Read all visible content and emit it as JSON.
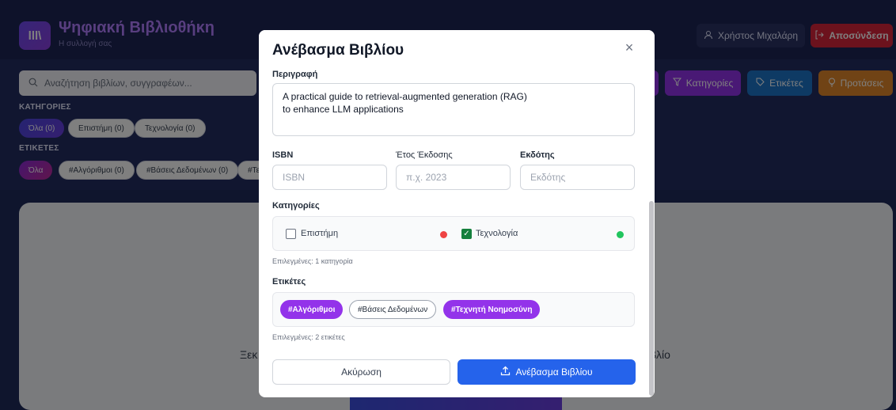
{
  "app": {
    "logo_text": "lll\\",
    "title": "Ψηφιακή Βιβλιοθήκη",
    "subtitle": "Η συλλογή σας",
    "user_name": "Χρήστος Μιχαλάρη",
    "logout_label": "Αποσύνδεση"
  },
  "search": {
    "placeholder": "Αναζήτηση βιβλίων, συγγραφέων..."
  },
  "filters": {
    "categories_label": "ΚΑΤΗΓΟΡΙΕΣ",
    "category_chips": [
      "Όλα (0)",
      "Επιστήμη (0)",
      "Τεχνολογία (0)"
    ],
    "tags_label": "ΕΤΙΚΕΤΕΣ",
    "tag_chips": [
      "Όλα",
      "#Αλγόριθμοι (0)",
      "#Βάσεις Δεδομένων (0)",
      "#Τε"
    ]
  },
  "toolbar": {
    "categories_label": "Κατηγορίες",
    "tags_label": "Ετικέτες",
    "suggestions_label": "Προτάσεις"
  },
  "background": {
    "empty_text_left": "Ξεκ",
    "empty_text_right": "βλίο"
  },
  "modal": {
    "title": "Ανέβασμα Βιβλίου",
    "close_icon": "×",
    "description_label": "Περιγραφή",
    "description_value": "A practical guide to retrieval-augmented generation (RAG)\nto enhance LLM applications",
    "isbn_label": "ISBN",
    "isbn_placeholder": "ISBN",
    "year_label": "Έτος Έκδοσης",
    "year_placeholder": "π.χ. 2023",
    "publisher_label": "Εκδότης",
    "publisher_placeholder": "Εκδότης",
    "categories_label": "Κατηγορίες",
    "categories": [
      {
        "name": "Επιστήμη",
        "checked": false,
        "color": "#ef4444"
      },
      {
        "name": "Τεχνολογία",
        "checked": true,
        "color": "#22c55e"
      }
    ],
    "categories_hint": "Επιλεγμένες: 1 κατηγορία",
    "tags_label": "Ετικέτες",
    "tags": [
      {
        "name": "#Αλγόριθμοι",
        "selected": true
      },
      {
        "name": "#Βάσεις Δεδομένων",
        "selected": false
      },
      {
        "name": "#Τεχνητή Νοημοσύνη",
        "selected": true
      }
    ],
    "tags_hint": "Επιλεγμένες: 2 ετικέτες",
    "cancel_label": "Ακύρωση",
    "upload_label": "Ανέβασμα Βιβλίου"
  },
  "colors": {
    "accent": "#2563eb",
    "tag_selected": "#9333ea",
    "logout": "#d8243a"
  }
}
